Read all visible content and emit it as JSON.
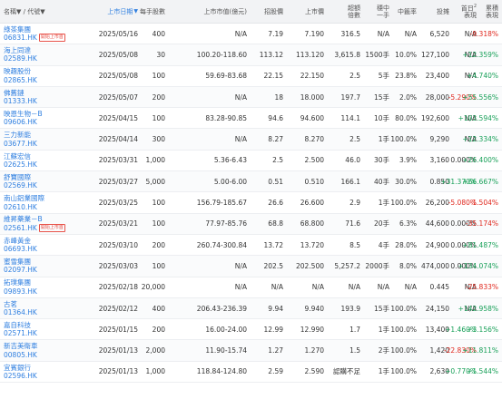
{
  "colors": {
    "accent": "#2f7fe0",
    "positive": "#18a058",
    "negative": "#e0281e",
    "tag": "#e8534a"
  },
  "header": {
    "name": "名稱▼ / 代號▼",
    "date": "上市日期",
    "date_sort": "▼",
    "lot": "每手股數",
    "cap": "上市市值(億元)",
    "price_range": "招股價",
    "listing_price": "上市價",
    "over_l1": "超額",
    "over_l2": "倍數",
    "lot_l1": "穩中",
    "lot_l2": "一手",
    "win_rate": "中籤率",
    "fund": "投摊",
    "day1_l1": "首日",
    "day1_sup": "2",
    "day1_l2": "表現",
    "cum_l1": "累積",
    "cum_l2": "表現"
  },
  "rows": [
    {
      "name": "綠茶集團",
      "code": "06831.HK",
      "tag": "開始上市首",
      "date": "2025/05/16",
      "lot": "400",
      "cap": "N/A",
      "range": "7.19",
      "price": "7.190",
      "over": "316.5",
      "lot1": "N/A",
      "win": "N/A",
      "fund": "6,520",
      "day1": "N/A",
      "day1_c": "",
      "cum": "-9.318%",
      "cum_c": "neg"
    },
    {
      "name": "海上同達",
      "code": "02589.HK",
      "tag": "",
      "date": "2025/05/08",
      "lot": "30",
      "cap": "100.20-118.60",
      "range": "113.12",
      "price": "113.120",
      "over": "3,615.8",
      "lot1": "1500手",
      "win": "10.0%",
      "fund": "127,100",
      "day1": "N/A",
      "day1_c": "",
      "cum": "+12.359%",
      "cum_c": "pos"
    },
    {
      "name": "映趣股份",
      "code": "02865.HK",
      "tag": "",
      "date": "2025/05/08",
      "lot": "100",
      "cap": "59.69-83.68",
      "range": "22.15",
      "price": "22.150",
      "over": "2.5",
      "lot1": "5手",
      "win": "23.8%",
      "fund": "23,400",
      "day1": "N/A",
      "day1_c": "",
      "cum": "+4.740%",
      "cum_c": "pos"
    },
    {
      "name": "佛舊鏈",
      "code": "01333.HK",
      "tag": "",
      "date": "2025/05/07",
      "lot": "200",
      "cap": "N/A",
      "range": "18",
      "price": "18.000",
      "over": "197.7",
      "lot1": "15手",
      "win": "2.0%",
      "fund": "28,000",
      "day1": "-5.290%",
      "day1_c": "neg",
      "cum": "+55.556%",
      "cum_c": "pos"
    },
    {
      "name": "映恩生物－B",
      "code": "09606.HK",
      "tag": "",
      "date": "2025/04/15",
      "lot": "100",
      "cap": "83.28-90.85",
      "range": "94.6",
      "price": "94.600",
      "over": "114.1",
      "lot1": "10手",
      "win": "80.0%",
      "fund": "192,600",
      "day1": "N/A",
      "day1_c": "",
      "cum": "+103.594%",
      "cum_c": "pos"
    },
    {
      "name": "三力新能",
      "code": "03677.HK",
      "tag": "",
      "date": "2025/04/14",
      "lot": "300",
      "cap": "N/A",
      "range": "8.27",
      "price": "8.270",
      "over": "2.5",
      "lot1": "1手",
      "win": "100.0%",
      "fund": "9,290",
      "day1": "N/A",
      "day1_c": "",
      "cum": "+12.334%",
      "cum_c": "pos"
    },
    {
      "name": "江蘇宏信",
      "code": "02625.HK",
      "tag": "",
      "date": "2025/03/31",
      "lot": "1,000",
      "cap": "5.36-6.43",
      "range": "2.5",
      "price": "2.500",
      "over": "46.0",
      "lot1": "30手",
      "win": "3.9%",
      "fund": "3,160",
      "day1": "0.000%",
      "day1_c": "",
      "cum": "+26.400%",
      "cum_c": "pos"
    },
    {
      "name": "舒寶國際",
      "code": "02569.HK",
      "tag": "",
      "date": "2025/03/27",
      "lot": "5,000",
      "cap": "5.00-6.00",
      "range": "0.51",
      "price": "0.510",
      "over": "166.1",
      "lot1": "40手",
      "win": "30.0%",
      "fund": "0.850",
      "day1": "+31.370%",
      "day1_c": "pos",
      "cum": "+66.667%",
      "cum_c": "pos"
    },
    {
      "name": "南山鋁業國際",
      "code": "02610.HK",
      "tag": "",
      "date": "2025/03/25",
      "lot": "100",
      "cap": "156.79-185.67",
      "range": "26.6",
      "price": "26.600",
      "over": "2.9",
      "lot1": "1手",
      "win": "100.0%",
      "fund": "26,200",
      "day1": "-5.080%",
      "day1_c": "neg",
      "cum": "-1.504%",
      "cum_c": "neg"
    },
    {
      "name": "維昇藥業－B",
      "code": "02561.HK",
      "tag": "開始上市首",
      "date": "2025/03/21",
      "lot": "100",
      "cap": "77.97-85.76",
      "range": "68.8",
      "price": "68.800",
      "over": "71.6",
      "lot1": "20手",
      "win": "6.3%",
      "fund": "44,600",
      "day1": "0.000%",
      "day1_c": "",
      "cum": "-35.174%",
      "cum_c": "neg"
    },
    {
      "name": "赤峰黃金",
      "code": "06693.HK",
      "tag": "",
      "date": "2025/03/10",
      "lot": "200",
      "cap": "260.74-300.84",
      "range": "13.72",
      "price": "13.720",
      "over": "8.5",
      "lot1": "4手",
      "win": "28.0%",
      "fund": "24,900",
      "day1": "0.000%",
      "day1_c": "",
      "cum": "+81.487%",
      "cum_c": "pos"
    },
    {
      "name": "蜜雪集團",
      "code": "02097.HK",
      "tag": "",
      "date": "2025/03/03",
      "lot": "100",
      "cap": "N/A",
      "range": "202.5",
      "price": "202.500",
      "over": "5,257.2",
      "lot1": "2000手",
      "win": "8.0%",
      "fund": "474,000",
      "day1": "0.000%",
      "day1_c": "",
      "cum": "+134.074%",
      "cum_c": "pos"
    },
    {
      "name": "拓璞集團",
      "code": "09893.HK",
      "tag": "",
      "date": "2025/02/18",
      "lot": "20,000",
      "cap": "N/A",
      "range": "N/A",
      "price": "N/A",
      "over": "N/A",
      "lot1": "N/A",
      "win": "N/A",
      "fund": "0.445",
      "day1": "N/A",
      "day1_c": "",
      "cum": "-25.833%",
      "cum_c": "neg"
    },
    {
      "name": "古茗",
      "code": "01364.HK",
      "tag": "",
      "date": "2025/02/12",
      "lot": "400",
      "cap": "206.43-236.39",
      "range": "9.94",
      "price": "9.940",
      "over": "193.9",
      "lot1": "15手",
      "win": "100.0%",
      "fund": "24,150",
      "day1": "N/A",
      "day1_c": "",
      "cum": "+142.958%",
      "cum_c": "pos"
    },
    {
      "name": "嘉自科技",
      "code": "02571.HK",
      "tag": "",
      "date": "2025/01/15",
      "lot": "200",
      "cap": "16.00-24.00",
      "range": "12.99",
      "price": "12.990",
      "over": "1.7",
      "lot1": "1手",
      "win": "100.0%",
      "fund": "13,400",
      "day1": "+1.460%",
      "day1_c": "pos",
      "cum": "+3.156%",
      "cum_c": "pos"
    },
    {
      "name": "新吉美衛車",
      "code": "00805.HK",
      "tag": "",
      "date": "2025/01/13",
      "lot": "2,000",
      "cap": "11.90-15.74",
      "range": "1.27",
      "price": "1.270",
      "over": "1.5",
      "lot1": "2手",
      "win": "100.0%",
      "fund": "1,420",
      "day1": "-22.830%",
      "day1_c": "neg",
      "cum": "+11.811%",
      "cum_c": "pos"
    },
    {
      "name": "宜賓銀行",
      "code": "02596.HK",
      "tag": "",
      "date": "2025/01/13",
      "lot": "1,000",
      "cap": "118.84-124.80",
      "range": "2.59",
      "price": "2.590",
      "over": "認購不足",
      "lot1": "1手",
      "win": "100.0%",
      "fund": "2,630",
      "day1": "+0.770%",
      "day1_c": "pos",
      "cum": "+1.544%",
      "cum_c": "pos"
    }
  ]
}
